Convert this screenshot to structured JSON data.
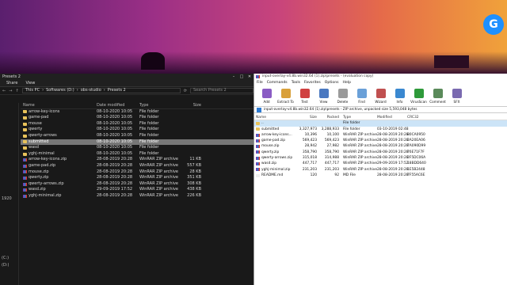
{
  "explorer": {
    "title": "Presets 2",
    "ribbon": [
      "Share",
      "View"
    ],
    "breadcrumb": [
      "This PC",
      "Softwares (D:)",
      "obs-studio",
      "Presets 2"
    ],
    "search_placeholder": "Search Presets 2",
    "nav_fragments": [
      "1920",
      "(C:)",
      "(D:)"
    ],
    "columns": {
      "name": "Name",
      "date": "Date modified",
      "type": "Type",
      "size": "Size"
    },
    "rows": [
      {
        "icon": "folder",
        "name": "arrow-key-icons",
        "date": "08-10-2020 10:05",
        "type": "File folder",
        "size": ""
      },
      {
        "icon": "folder",
        "name": "game-pad",
        "date": "08-10-2020 10:05",
        "type": "File folder",
        "size": ""
      },
      {
        "icon": "folder",
        "name": "mouse",
        "date": "08-10-2020 10:05",
        "type": "File folder",
        "size": ""
      },
      {
        "icon": "folder",
        "name": "qwerty",
        "date": "08-10-2020 10:05",
        "type": "File folder",
        "size": ""
      },
      {
        "icon": "folder",
        "name": "qwerty-arrows",
        "date": "08-10-2020 10:05",
        "type": "File folder",
        "size": ""
      },
      {
        "icon": "folder",
        "name": "submitted",
        "date": "08-10-2020 10:05",
        "type": "File folder",
        "size": "",
        "selected": true
      },
      {
        "icon": "folder",
        "name": "wasd",
        "date": "08-10-2020 10:05",
        "type": "File folder",
        "size": ""
      },
      {
        "icon": "folder",
        "name": "yghj-minimal",
        "date": "08-10-2020 10:05",
        "type": "File folder",
        "size": ""
      },
      {
        "icon": "zip",
        "name": "arrow-key-icons.zip",
        "date": "28-08-2019 20:28",
        "type": "WinRAR ZIP archive",
        "size": "11 KB"
      },
      {
        "icon": "zip",
        "name": "game-pad.zip",
        "date": "28-08-2019 20:28",
        "type": "WinRAR ZIP archive",
        "size": "557 KB"
      },
      {
        "icon": "zip",
        "name": "mouse.zip",
        "date": "28-08-2019 20:28",
        "type": "WinRAR ZIP archive",
        "size": "28 KB"
      },
      {
        "icon": "zip",
        "name": "qwerty.zip",
        "date": "28-08-2019 20:28",
        "type": "WinRAR ZIP archive",
        "size": "351 KB"
      },
      {
        "icon": "zip",
        "name": "qwerty-arrows.zip",
        "date": "28-08-2019 20:28",
        "type": "WinRAR ZIP archive",
        "size": "308 KB"
      },
      {
        "icon": "zip",
        "name": "wasd.zip",
        "date": "29-09-2019 17:52",
        "type": "WinRAR ZIP archive",
        "size": "438 KB"
      },
      {
        "icon": "zip",
        "name": "yghj-minimal.zip",
        "date": "28-08-2019 20:28",
        "type": "WinRAR ZIP archive",
        "size": "226 KB"
      }
    ]
  },
  "winrar": {
    "title": "input-overlay-v4.8b.win32.64 (1).zip\\presets - (evaluation copy)",
    "menu": [
      "File",
      "Commands",
      "Tools",
      "Favorites",
      "Options",
      "Help"
    ],
    "tools": [
      {
        "label": "Add",
        "icon": "add-icon",
        "color": "#8a5cc4"
      },
      {
        "label": "Extract To",
        "icon": "extract-icon",
        "color": "#d9a03a"
      },
      {
        "label": "Test",
        "icon": "test-icon",
        "color": "#d04040"
      },
      {
        "label": "View",
        "icon": "view-icon",
        "color": "#4a78c0"
      },
      {
        "label": "Delete",
        "icon": "delete-icon",
        "color": "#9a9a9a"
      },
      {
        "label": "Find",
        "icon": "find-icon",
        "color": "#6aa0d8"
      },
      {
        "label": "Wizard",
        "icon": "wizard-icon",
        "color": "#c05050"
      },
      {
        "label": "Info",
        "icon": "info-icon",
        "color": "#3a88d0"
      },
      {
        "label": "VirusScan",
        "icon": "virusscan-icon",
        "color": "#2e9a3a"
      },
      {
        "label": "Comment",
        "icon": "comment-icon",
        "color": "#5a8a5a"
      },
      {
        "label": "SFX",
        "icon": "sfx-icon",
        "color": "#7a6ab0"
      }
    ],
    "path": "input-overlay-v4.8b.win32.64 (1).zip\\presets - ZIP archive, unpacked size 5,593,048 bytes",
    "columns": {
      "name": "Name",
      "size": "Size",
      "packed": "Packed",
      "type": "Type",
      "modified": "Modified",
      "crc": "CRC32"
    },
    "rows": [
      {
        "icon": "folder",
        "name": "..",
        "size": "",
        "packed": "",
        "type": "File folder",
        "modified": "",
        "crc": ""
      },
      {
        "icon": "folder",
        "name": "submitted",
        "size": "3,327,973",
        "packed": "3,288,933",
        "type": "File folder",
        "modified": "03-10-2019 02:48",
        "crc": ""
      },
      {
        "icon": "zip",
        "name": "arrow-key-icons...",
        "size": "10,396",
        "packed": "10,100",
        "type": "WinRAR ZIP archive",
        "modified": "28-08-2019 20:28",
        "crc": "80CA0950"
      },
      {
        "icon": "zip",
        "name": "game-pad.zip",
        "size": "569,423",
        "packed": "569,423",
        "type": "WinRAR ZIP archive",
        "modified": "28-08-2019 20:28",
        "crc": "2A20EA06"
      },
      {
        "icon": "zip",
        "name": "mouse.zip",
        "size": "28,942",
        "packed": "27,982",
        "type": "WinRAR ZIP archive",
        "modified": "28-08-2019 20:28",
        "crc": "7A090D99"
      },
      {
        "icon": "zip",
        "name": "qwerty.zip",
        "size": "358,790",
        "packed": "358,790",
        "type": "WinRAR ZIP archive",
        "modified": "28-08-2019 20:28",
        "crc": "76E71F7F"
      },
      {
        "icon": "zip",
        "name": "qwerty-arrows.zip",
        "size": "315,018",
        "packed": "314,988",
        "type": "WinRAR ZIP archive",
        "modified": "28-08-2019 20:28",
        "crc": "2F5DC06A"
      },
      {
        "icon": "zip",
        "name": "wasd.zip",
        "size": "447,717",
        "packed": "447,717",
        "type": "WinRAR ZIP archive",
        "modified": "29-09-2019 17:52",
        "crc": "18BDD640"
      },
      {
        "icon": "zip",
        "name": "yghj-minimal.zip",
        "size": "231,203",
        "packed": "231,203",
        "type": "WinRAR ZIP archive",
        "modified": "28-08-2019 20:28",
        "crc": "1E5B2448"
      },
      {
        "icon": "file",
        "name": "README.md",
        "size": "120",
        "packed": "92",
        "type": "MD File",
        "modified": "28-08-2019 20:28",
        "crc": "7F55AC6E"
      }
    ]
  }
}
